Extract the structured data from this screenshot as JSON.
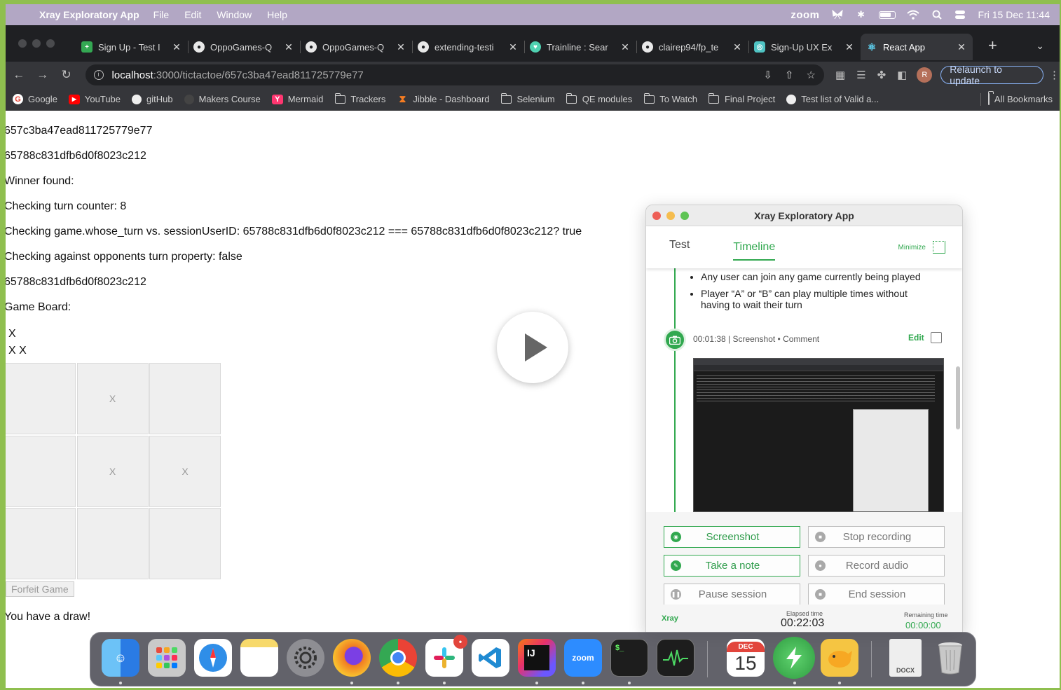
{
  "menubar": {
    "app_name": "Xray Exploratory App",
    "menus": [
      "File",
      "Edit",
      "Window",
      "Help"
    ],
    "zoom": "zoom",
    "datetime": "Fri 15 Dec  11:44"
  },
  "browser": {
    "tabs": [
      {
        "label": "Sign Up - Test I",
        "icon": "sheets-icon",
        "color": "#34a853"
      },
      {
        "label": "OppoGames-Q",
        "icon": "github-icon",
        "color": "#e8e8e8"
      },
      {
        "label": "OppoGames-Q",
        "icon": "github-icon",
        "color": "#e8e8e8"
      },
      {
        "label": "extending-testi",
        "icon": "github-icon",
        "color": "#e8e8e8"
      },
      {
        "label": "Trainline : Sear",
        "icon": "trainline-icon",
        "color": "#4fd1b1"
      },
      {
        "label": "clairep94/fp_te",
        "icon": "github-icon",
        "color": "#e8e8e8"
      },
      {
        "label": "Sign-Up UX Ex",
        "icon": "doc-icon",
        "color": "#4fc3c3"
      },
      {
        "label": "React App",
        "icon": "react-icon",
        "color": "#61dafb"
      }
    ],
    "url_host": "localhost",
    "url_path": ":3000/tictactoe/657c3ba47ead811725779e77",
    "relaunch_label": "Relaunch to update",
    "profile_initial": "R",
    "bookmarks": [
      {
        "label": "Google",
        "icon": "google-icon"
      },
      {
        "label": "YouTube",
        "icon": "youtube-icon"
      },
      {
        "label": "gitHub",
        "icon": "github-icon"
      },
      {
        "label": "Makers Course",
        "icon": "makers-icon"
      },
      {
        "label": "Mermaid",
        "icon": "mermaid-icon"
      },
      {
        "label": "Trackers",
        "icon": "folder-icon"
      },
      {
        "label": "Jibble - Dashboard",
        "icon": "jibble-icon"
      },
      {
        "label": "Selenium",
        "icon": "folder-icon"
      },
      {
        "label": "QE modules",
        "icon": "folder-icon"
      },
      {
        "label": "To Watch",
        "icon": "folder-icon"
      },
      {
        "label": "Final Project",
        "icon": "folder-icon"
      },
      {
        "label": "Test list of Valid a...",
        "icon": "github-icon"
      }
    ],
    "all_bookmarks": "All Bookmarks"
  },
  "page": {
    "lines": [
      "657c3ba47ead811725779e77",
      "65788c831dfb6d0f8023c212",
      "Winner found:",
      "Checking turn counter: 8",
      "Checking game.whose_turn vs. sessionUserID: 65788c831dfb6d0f8023c212 === 65788c831dfb6d0f8023c212? true",
      "Checking against opponents turn property: false",
      "65788c831dfb6d0f8023c212",
      "Game Board:"
    ],
    "board_text_1": "X",
    "board_text_2": "X X",
    "cells": [
      "",
      "X",
      "",
      "",
      "X",
      "X",
      "",
      "",
      ""
    ],
    "forfeit_label": "Forfeit Game",
    "result": "You have a draw!"
  },
  "xray": {
    "title": "Xray Exploratory App",
    "tab_test": "Test",
    "tab_timeline": "Timeline",
    "minimize": "Minimize",
    "bullets": [
      "Any user can join any game currently being played",
      "Player “A” or “B” can play multiple times without having to wait their turn"
    ],
    "entry_meta": "00:01:38 | Screenshot • Comment",
    "edit": "Edit",
    "buttons": {
      "screenshot": "Screenshot",
      "stop_recording": "Stop recording",
      "take_note": "Take a note",
      "record_audio": "Record audio",
      "pause_session": "Pause session",
      "end_session": "End session"
    },
    "logo": "Xray",
    "elapsed_label": "Elapsed time",
    "elapsed_value": "00:22:03",
    "remaining_label": "Remaining time",
    "remaining_value": "00:00:00",
    "accent": "#31a84f"
  },
  "dock": {
    "apps": [
      {
        "name": "finder-icon",
        "color": "#3aa0f0"
      },
      {
        "name": "launchpad-icon",
        "color": "#d8d8d8"
      },
      {
        "name": "safari-icon",
        "color": "#2f8ee8"
      },
      {
        "name": "notes-icon",
        "color": "#f7d96b"
      },
      {
        "name": "system-settings-icon",
        "color": "#8e8e93"
      },
      {
        "name": "firefox-icon",
        "color": "#f07b22"
      },
      {
        "name": "chrome-icon",
        "color": "#e8e8e8"
      },
      {
        "name": "slack-icon",
        "color": "#ffffff"
      },
      {
        "name": "vscode-icon",
        "color": "#ffffff"
      },
      {
        "name": "intellij-icon",
        "color": "#111111"
      },
      {
        "name": "zoom-icon",
        "color": "#2d8cff"
      },
      {
        "name": "terminal-icon",
        "color": "#1d1d1d"
      },
      {
        "name": "activity-monitor-icon",
        "color": "#1d1d1d"
      },
      {
        "name": "calendar-icon",
        "color": "#ffffff"
      },
      {
        "name": "xray-icon",
        "color": "#3cb551"
      },
      {
        "name": "tableplus-icon",
        "color": "#f5c542"
      },
      {
        "name": "document-icon",
        "color": "#eeeeee"
      },
      {
        "name": "trash-icon",
        "color": "#c8c8c8"
      }
    ],
    "zoom_label": "zoom",
    "calendar_month": "DEC",
    "calendar_day": "15",
    "intellij_label": "IJ",
    "terminal_label": "$_",
    "doc_label": "DOCX",
    "slack_badge": "•"
  }
}
